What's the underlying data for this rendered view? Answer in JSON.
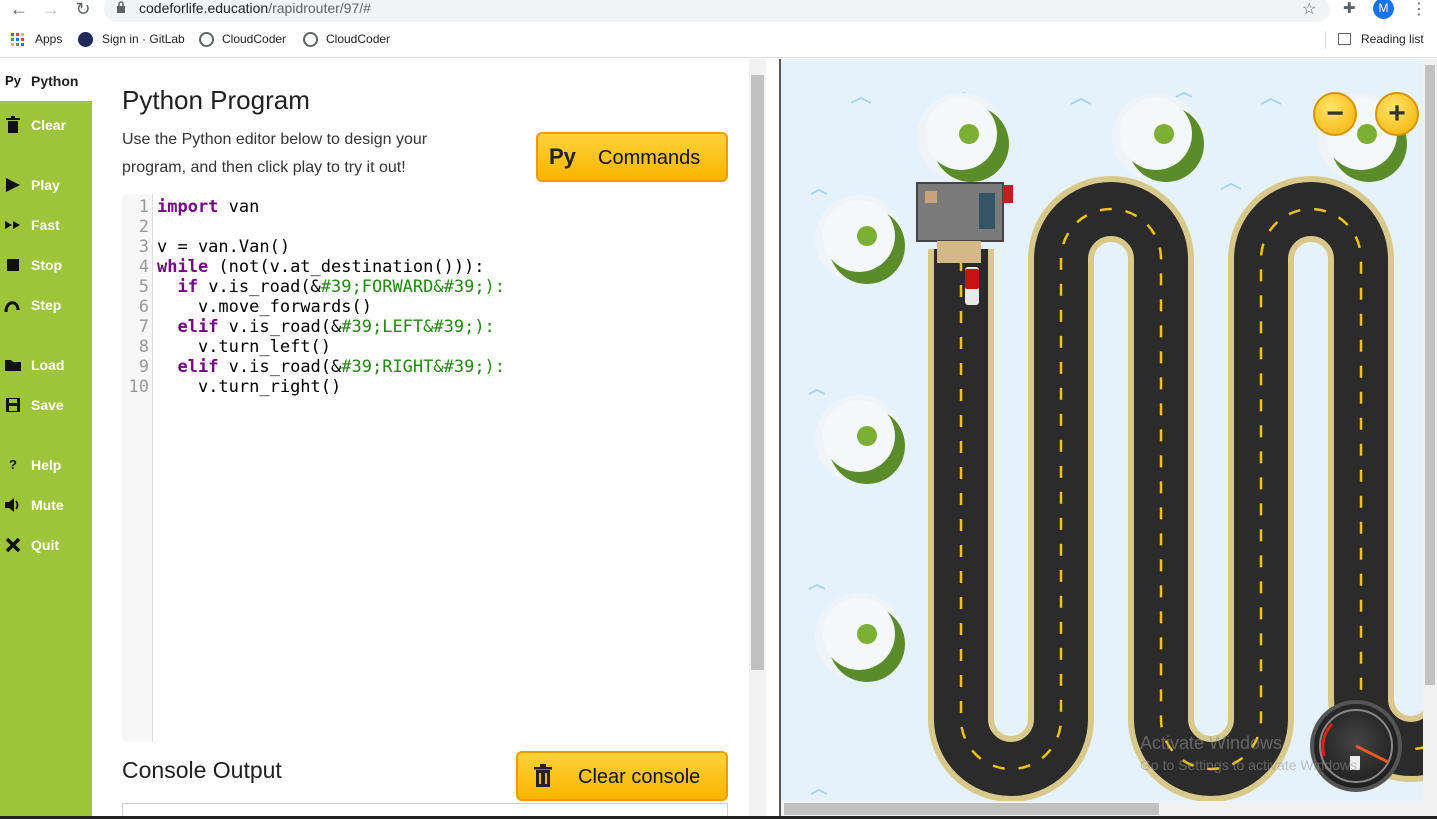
{
  "browser": {
    "url_domain": "codeforlife.education",
    "url_path": "/rapidrouter/97/#",
    "avatar_letter": "M",
    "bookmarks": [
      "Apps",
      "Sign in · GitLab",
      "CloudCoder",
      "CloudCoder"
    ],
    "reading_list": "Reading list"
  },
  "sidebar": {
    "python": {
      "icon": "Py",
      "label": "Python"
    },
    "items": [
      {
        "label": "Clear",
        "icon": "trash-icon"
      },
      {
        "label": "Play",
        "icon": "play-icon"
      },
      {
        "label": "Fast",
        "icon": "fast-forward-icon"
      },
      {
        "label": "Stop",
        "icon": "stop-icon"
      },
      {
        "label": "Step",
        "icon": "step-icon"
      },
      {
        "label": "Load",
        "icon": "folder-icon"
      },
      {
        "label": "Save",
        "icon": "save-icon"
      },
      {
        "label": "Help",
        "icon": "help-icon"
      },
      {
        "label": "Mute",
        "icon": "speaker-icon"
      },
      {
        "label": "Quit",
        "icon": "close-icon"
      }
    ]
  },
  "editor": {
    "title": "Python Program",
    "description": "Use the Python editor below to design your program, and then click play to try it out!",
    "commands_button": {
      "icon": "Py",
      "label": "Commands"
    },
    "line_numbers": [
      "1",
      "2",
      "3",
      "4",
      "5",
      "6",
      "7",
      "8",
      "9",
      "10"
    ],
    "lines": [
      [
        "",
        "import",
        " van",
        ""
      ],
      [
        "",
        "",
        "",
        ""
      ],
      [
        "",
        "",
        "v = van.Van()",
        ""
      ],
      [
        "",
        "while",
        " (not(v.at_destination())):",
        ""
      ],
      [
        "  ",
        "if",
        " v.is_road(&",
        "#39;FORWARD&#39;):"
      ],
      [
        "    ",
        "",
        "v.move_forwards()",
        ""
      ],
      [
        "  ",
        "elif",
        " v.is_road(&",
        "#39;LEFT&#39;):"
      ],
      [
        "    ",
        "",
        "v.turn_left()",
        ""
      ],
      [
        "  ",
        "elif",
        " v.is_road(&",
        "#39;RIGHT&#39;):"
      ],
      [
        "    ",
        "",
        "v.turn_right()",
        ""
      ]
    ]
  },
  "console": {
    "title": "Console Output",
    "clear_button_label": "Clear console"
  },
  "game": {
    "zoom_out": "−",
    "zoom_in": "+",
    "watermark_title": "Activate Windows",
    "watermark_sub": "Go to Settings to activate Windows."
  }
}
